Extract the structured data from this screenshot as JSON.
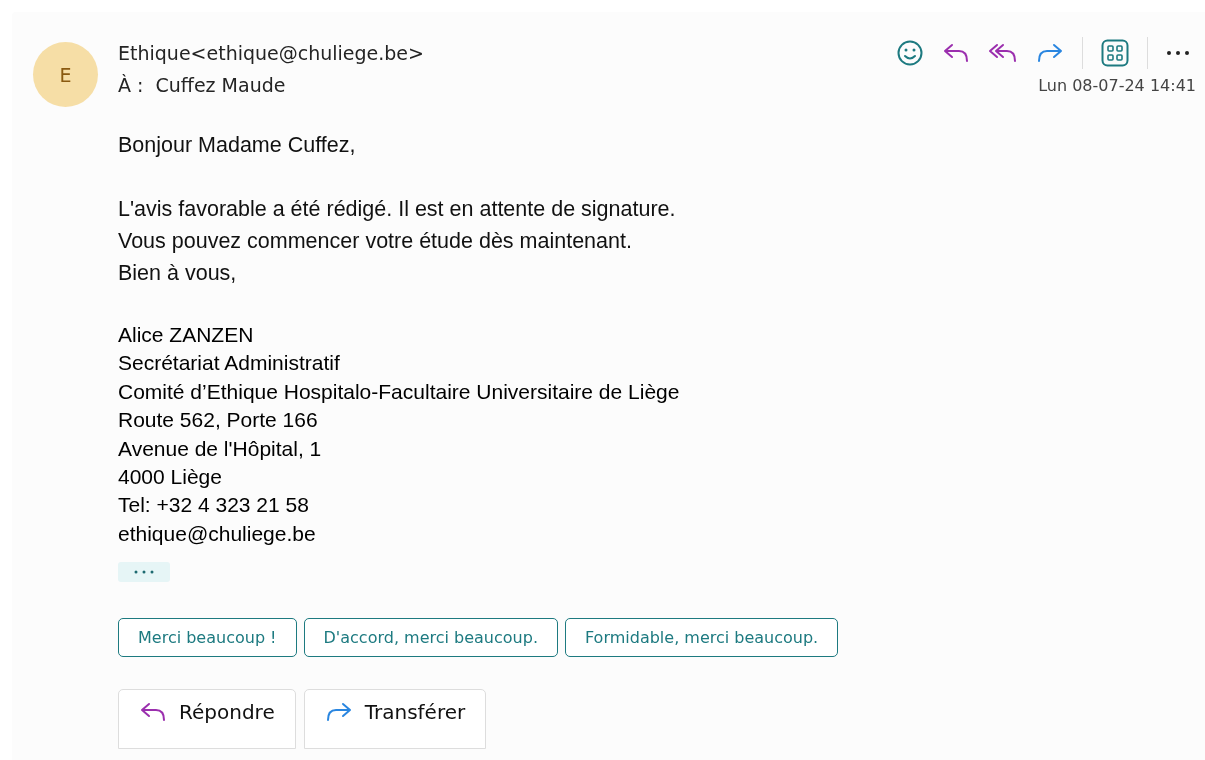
{
  "sender": {
    "initial": "E",
    "name": "Ethique<ethique@chuliege.be>"
  },
  "recipient": {
    "label": "À :",
    "name": "Cuffez Maude"
  },
  "date": "Lun 08-07-24 14:41",
  "body": [
    "Bonjour Madame Cuffez,",
    "L'avis favorable a été rédigé. Il est en attente de signature.",
    "Vous pouvez commencer votre étude dès maintenant.",
    "Bien à vous,"
  ],
  "signature": [
    "Alice ZANZEN",
    "Secrétariat Administratif",
    "Comité d’Ethique Hospitalo-Facultaire Universitaire de Liège",
    "Route 562, Porte 166",
    "Avenue de l'Hôpital, 1",
    "4000 Liège",
    "Tel: +32 4 323 21 58",
    "ethique@chuliege.be"
  ],
  "quick_replies": [
    "Merci beaucoup !",
    "D'accord, merci beaucoup.",
    "Formidable, merci beaucoup."
  ],
  "actions": [
    {
      "kind": "reply",
      "label": "Répondre"
    },
    {
      "kind": "forward",
      "label": "Transférer"
    }
  ]
}
